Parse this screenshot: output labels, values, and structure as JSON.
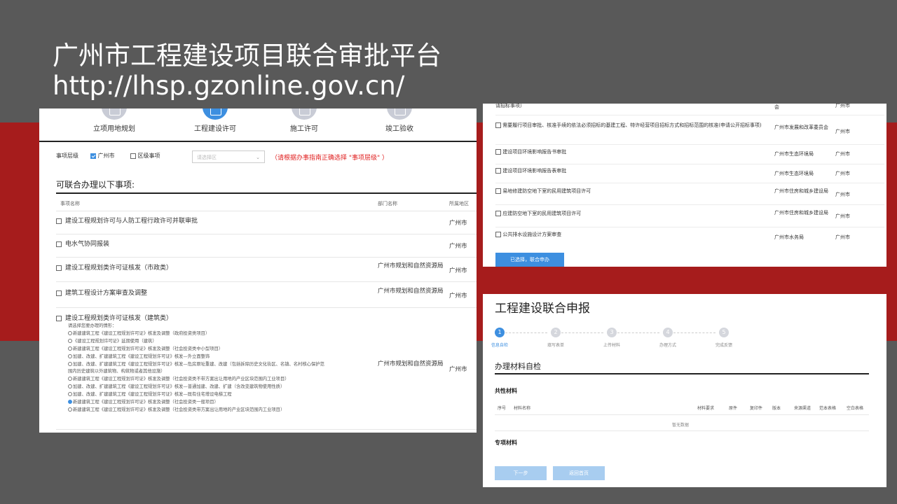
{
  "slide": {
    "title": "广州市工程建设项目联合审批平台",
    "url": "http://lhsp.gzonline.gov.cn/"
  },
  "colors": {
    "background": "#595959",
    "band": "#a61c1c",
    "accent": "#3d8fe0",
    "warning": "#e02020"
  },
  "panel1": {
    "steps": [
      {
        "label": "立项用地规划",
        "icon": "land-planning-icon",
        "active": false
      },
      {
        "label": "工程建设许可",
        "icon": "construction-permit-icon",
        "active": true
      },
      {
        "label": "施工许可",
        "icon": "build-permit-icon",
        "active": false
      },
      {
        "label": "竣工验收",
        "icon": "completion-icon",
        "active": false
      }
    ],
    "level_label": "事项层级",
    "option_city": "广州市",
    "option_district": "区级事项",
    "district_placeholder": "请选择区",
    "warning": "（请根据办事指南正确选择 \"事项层级\" ）",
    "section_title": "可联合办理以下事项:",
    "headers": {
      "name": "事项名称",
      "dept": "部门名称",
      "area": "所属地区"
    },
    "rows": [
      {
        "name": "建设工程规划许可与人防工程行政许可并联审批",
        "dept": "",
        "area": "广州市"
      },
      {
        "name": "电水气协同报装",
        "dept": "",
        "area": "广州市"
      },
      {
        "name": "建设工程规划类许可证核发（市政类）",
        "dept": "广州市规划和自然资源局",
        "area": "广州市"
      },
      {
        "name": "建筑工程设计方案审查及调整",
        "dept": "广州市规划和自然资源局",
        "area": "广州市"
      },
      {
        "name": "建设工程规划类许可证核发（建筑类）",
        "dept": "广州市规划和自然资源局",
        "area": "广州市"
      }
    ],
    "sub_prompt": "请选择您要办理的情形：",
    "sub_options": [
      "新建建筑工程《建设工程规划许可证》核发及调整（政府投资类项目）",
      "《建设工程规划许可证》延期使用（建筑）",
      "新建建筑工程《建设工程规划许可证》核发及调整（社会投资类中小型项目）",
      "加建、改建、扩建建筑工程《建设工程规划许可证》核发—外立面整饰",
      "加建、改建、扩建建筑工程《建设工程规划许可证》核发—危房原址重建、改建（包括拆除历史文化街区、名镇、名村核心保护范",
      "围内历史建筑以外建筑物、构筑物或者其他设施）",
      "新建建筑工程《建设工程规划许可证》核发及调整（社会投资类不带方案出让用地的产业区块范围内工业项目）",
      "加建、改建、扩建建筑工程《建设工程规划许可证》核发—普通加建、改建、扩建（含改变建筑物使用性质）",
      "加建、改建、扩建建筑工程《建设工程规划许可证》核发—既有住宅增设电梯工程",
      "新建建筑工程《建设工程规划许可证》核发及调整（社会投资类一般项目）",
      "新建建筑工程《建设工程规划许可证》核发及调整（社会投资类带方案出让用地的产业区块范围内工业项目）"
    ],
    "selected_option": 9
  },
  "panel2": {
    "top_fragment": {
      "name": "请招标事项）",
      "dept": "会",
      "area": "广州市"
    },
    "rows": [
      {
        "name": "需要履行项目审批、核准手续的依法必须招标的基建工程、特许经营项目招标方式和招标范围的核准(申请公开招标事项)",
        "dept": "广州市发展和改革委员会",
        "area": "广州市"
      },
      {
        "name": "建设项目环境影响报告书审批",
        "dept": "广州市生态环境局",
        "area": "广州市"
      },
      {
        "name": "建设项目环境影响报告表审批",
        "dept": "广州市生态环境局",
        "area": "广州市"
      },
      {
        "name": "易地修建防空地下室的民用建筑项目许可",
        "dept": "广州市住房和城乡建设局",
        "area": "广州市"
      },
      {
        "name": "应建防空地下室的民用建筑项目许可",
        "dept": "广州市住房和城乡建设局",
        "area": "广州市"
      },
      {
        "name": "公共排水设施设计方案审查",
        "dept": "广州市水务局",
        "area": "广州市"
      }
    ],
    "submit": "已选择，联合申办"
  },
  "panel3": {
    "title": "工程建设联合申报",
    "wizard": [
      {
        "num": "1",
        "label": "信息自检"
      },
      {
        "num": "2",
        "label": "填写表单"
      },
      {
        "num": "3",
        "label": "上传材料"
      },
      {
        "num": "4",
        "label": "办理方式"
      },
      {
        "num": "5",
        "label": "完成反馈"
      }
    ],
    "section": "办理材料自检",
    "common": "共性材料",
    "headers": [
      "序号",
      "材料名称",
      "材料要求",
      "原件",
      "复印件",
      "版本",
      "来源渠道",
      "范本表格",
      "空白表格"
    ],
    "no_data": "暂无数据",
    "special": "专项材料",
    "next": "下一步",
    "back": "返回首页"
  }
}
